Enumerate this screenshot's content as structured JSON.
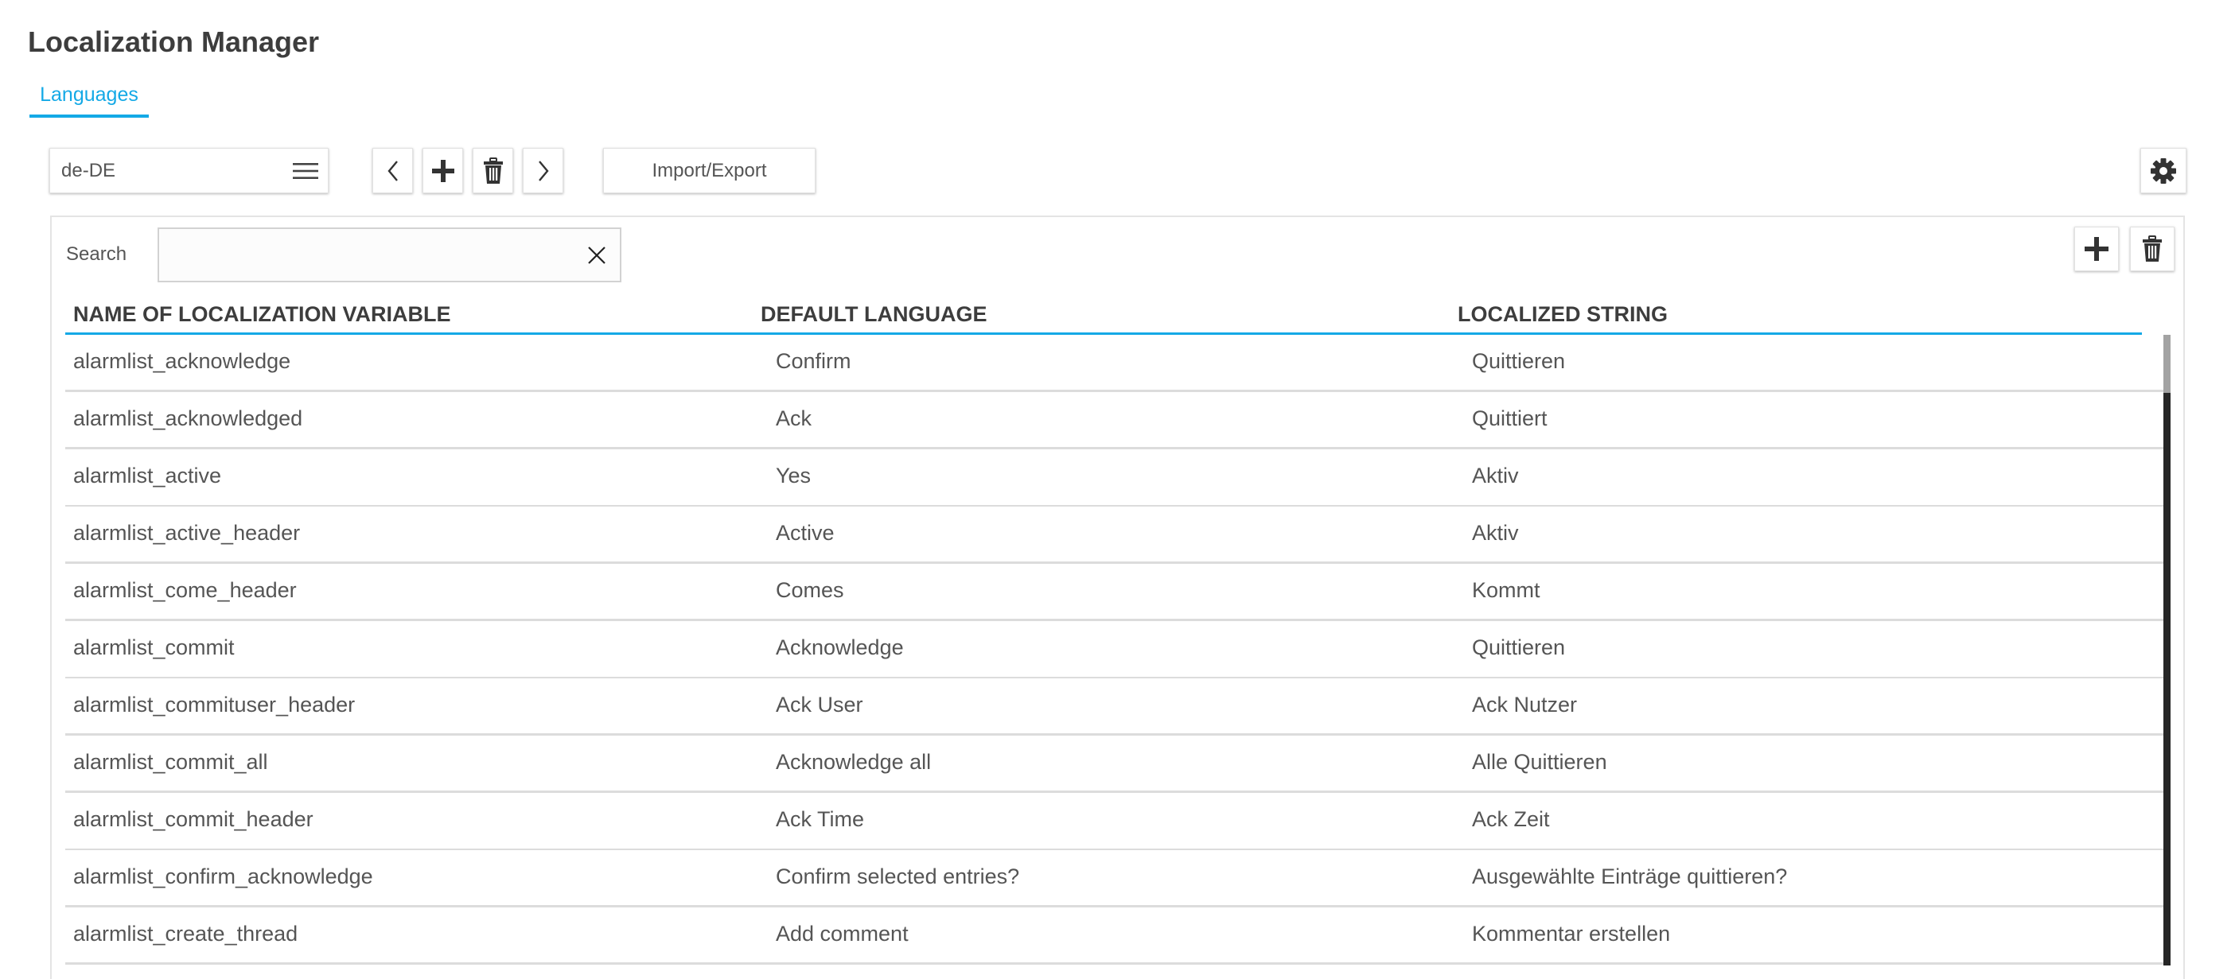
{
  "header": {
    "title": "Localization Manager"
  },
  "tabs": [
    {
      "label": "Languages",
      "active": true
    }
  ],
  "toolbar": {
    "language_select": {
      "value": "de-DE",
      "icon": "hamburger-menu-icon"
    },
    "prev_icon": "chevron-left-icon",
    "add_icon": "plus-icon",
    "delete_icon": "trash-icon",
    "next_icon": "chevron-right-icon",
    "import_export_label": "Import/Export",
    "settings_icon": "gear-icon"
  },
  "search": {
    "label": "Search",
    "value": "",
    "placeholder": "",
    "clear_icon": "close-icon"
  },
  "panel_actions": {
    "add_icon": "plus-icon",
    "delete_icon": "trash-icon"
  },
  "table": {
    "columns": [
      "NAME OF LOCALIZATION VARIABLE",
      "DEFAULT LANGUAGE",
      "LOCALIZED STRING"
    ],
    "rows": [
      {
        "name": "alarmlist_acknowledge",
        "default": "Confirm",
        "localized": "Quittieren"
      },
      {
        "name": "alarmlist_acknowledged",
        "default": "Ack",
        "localized": "Quittiert"
      },
      {
        "name": "alarmlist_active",
        "default": "Yes",
        "localized": "Aktiv"
      },
      {
        "name": "alarmlist_active_header",
        "default": "Active",
        "localized": "Aktiv"
      },
      {
        "name": "alarmlist_come_header",
        "default": "Comes",
        "localized": "Kommt"
      },
      {
        "name": "alarmlist_commit",
        "default": "Acknowledge",
        "localized": "Quittieren"
      },
      {
        "name": "alarmlist_commituser_header",
        "default": "Ack User",
        "localized": "Ack Nutzer"
      },
      {
        "name": "alarmlist_commit_all",
        "default": "Acknowledge all",
        "localized": "Alle Quittieren"
      },
      {
        "name": "alarmlist_commit_header",
        "default": "Ack Time",
        "localized": "Ack Zeit"
      },
      {
        "name": "alarmlist_confirm_acknowledge",
        "default": "Confirm selected entries?",
        "localized": "Ausgewählte Einträge quittieren?"
      },
      {
        "name": "alarmlist_create_thread",
        "default": "Add comment",
        "localized": "Kommentar erstellen"
      }
    ]
  },
  "colors": {
    "accent": "#14a9e6",
    "text": "#444444",
    "scrollbar_track": "#262626",
    "scrollbar_thumb": "#a3a3a3"
  }
}
